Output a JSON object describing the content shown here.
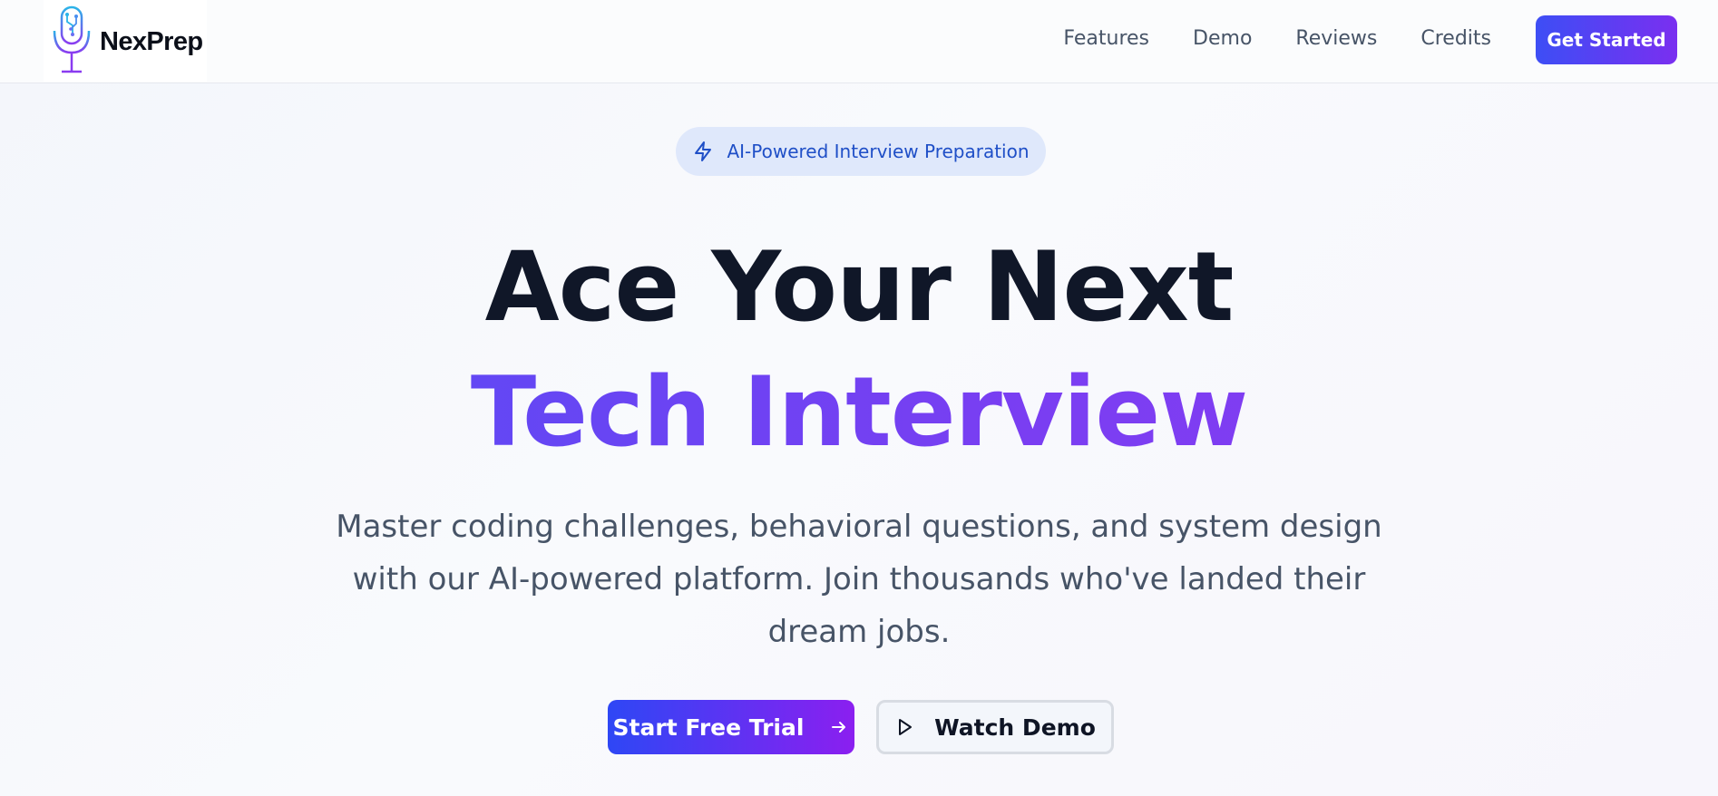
{
  "brand": {
    "name": "NexPrep",
    "logo_icon": "microphone-circuit-icon"
  },
  "nav": {
    "links": [
      "Features",
      "Demo",
      "Reviews",
      "Credits"
    ],
    "cta_label": "Get Started"
  },
  "hero": {
    "badge": {
      "icon": "lightning-bolt-icon",
      "text": "AI-Powered Interview Preparation"
    },
    "headline_line1": "Ace Your Next",
    "headline_line2": "Tech Interview",
    "subtitle": "Master coding challenges, behavioral questions, and system design with our AI-powered platform. Join thousands who've landed their dream jobs.",
    "primary_button": {
      "label": "Start Free Trial",
      "icon": "arrow-right-icon"
    },
    "secondary_button": {
      "label": "Watch Demo",
      "icon": "play-icon"
    }
  },
  "colors": {
    "accent_start": "#2e47f5",
    "accent_end": "#8b1ff0",
    "heading": "#101728",
    "body_text": "#475467",
    "badge_bg": "#dfe8fb",
    "badge_text": "#1f4fc7"
  }
}
